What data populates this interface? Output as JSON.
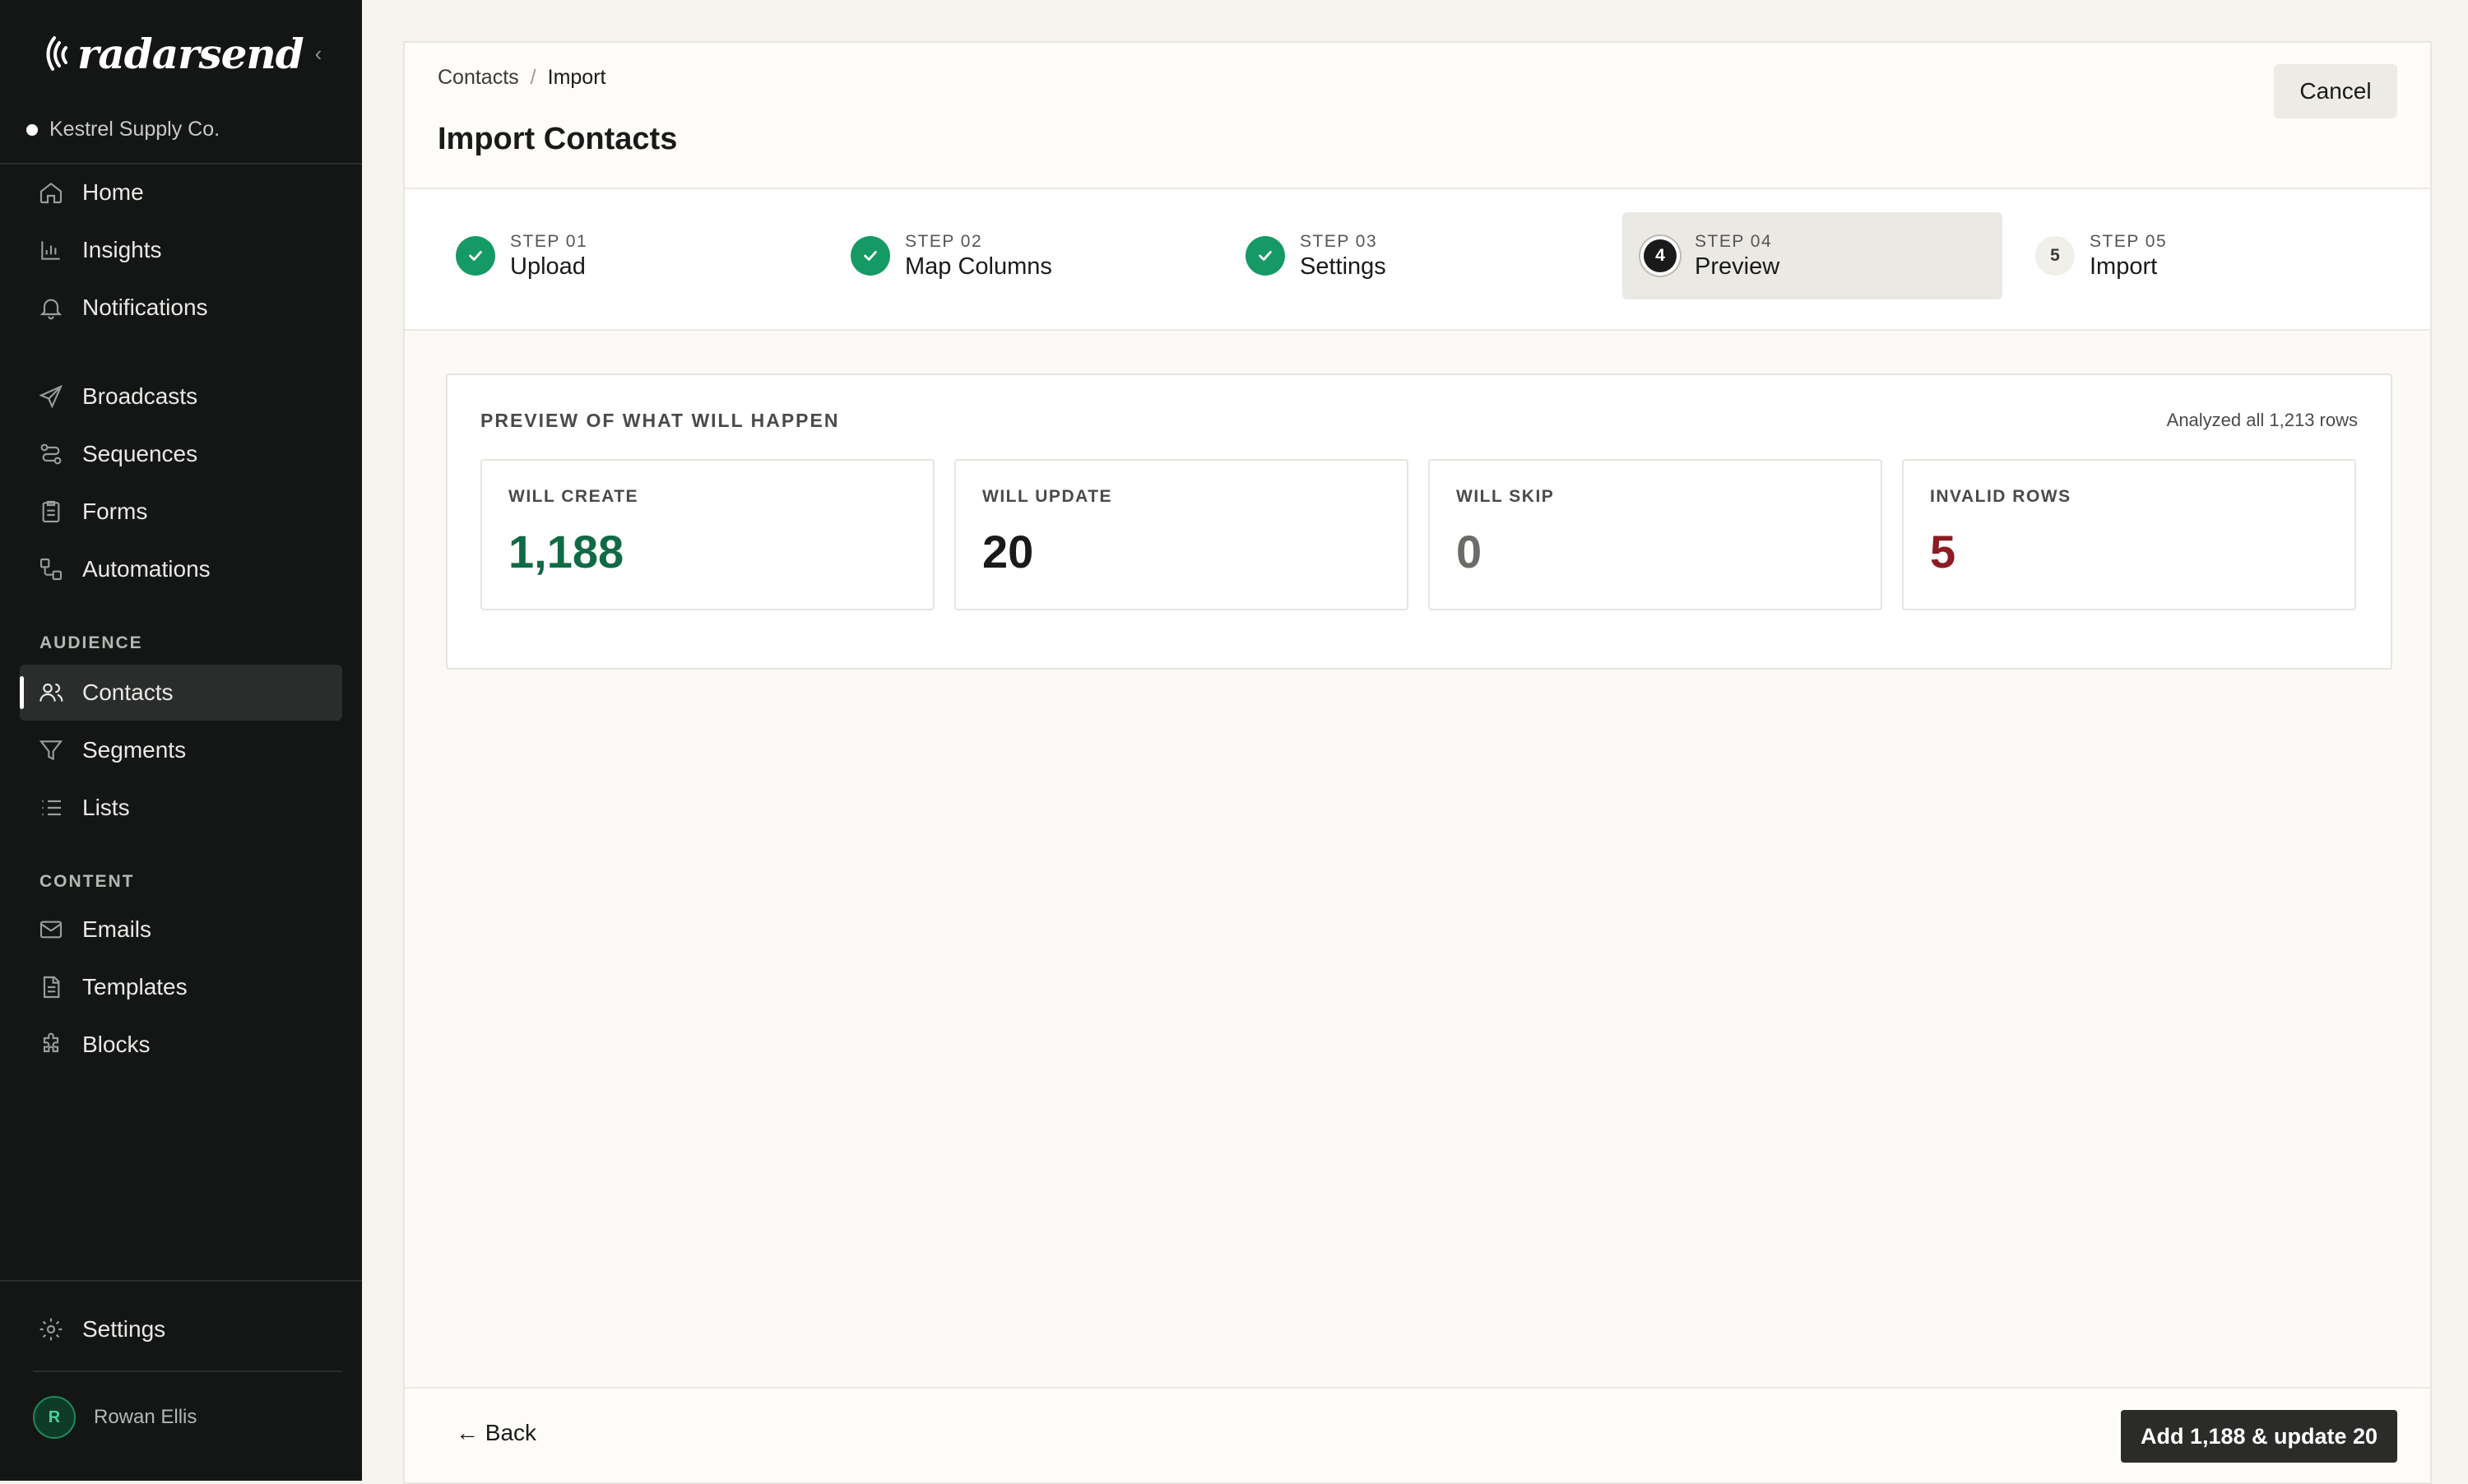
{
  "app": {
    "brand": "radarsend",
    "workspace": "Kestrel Supply Co."
  },
  "sidebar": {
    "collapse_glyph": "‹",
    "main_items": [
      {
        "label": "Home",
        "icon": "home-icon"
      },
      {
        "label": "Insights",
        "icon": "chart-icon"
      },
      {
        "label": "Notifications",
        "icon": "bell-icon"
      }
    ],
    "engage_items": [
      {
        "label": "Broadcasts",
        "icon": "send-icon"
      },
      {
        "label": "Sequences",
        "icon": "sequence-icon"
      },
      {
        "label": "Forms",
        "icon": "clipboard-icon"
      },
      {
        "label": "Automations",
        "icon": "workflow-icon"
      }
    ],
    "audience_label": "AUDIENCE",
    "audience_items": [
      {
        "label": "Contacts",
        "icon": "users-icon",
        "active": true
      },
      {
        "label": "Segments",
        "icon": "filter-icon"
      },
      {
        "label": "Lists",
        "icon": "list-icon"
      }
    ],
    "content_label": "CONTENT",
    "content_items": [
      {
        "label": "Emails",
        "icon": "mail-icon"
      },
      {
        "label": "Templates",
        "icon": "document-icon"
      },
      {
        "label": "Blocks",
        "icon": "puzzle-icon"
      }
    ],
    "settings": {
      "label": "Settings",
      "icon": "gear-icon"
    },
    "user": {
      "initial": "R",
      "name": "Rowan Ellis"
    }
  },
  "header": {
    "breadcrumb": [
      "Contacts",
      "Import"
    ],
    "breadcrumb_sep": "/",
    "title": "Import Contacts",
    "cancel_label": "Cancel"
  },
  "steps": [
    {
      "label": "STEP 01",
      "name": "Upload",
      "state": "done"
    },
    {
      "label": "STEP 02",
      "name": "Map Columns",
      "state": "done"
    },
    {
      "label": "STEP 03",
      "name": "Settings",
      "state": "done"
    },
    {
      "label": "STEP 04",
      "name": "Preview",
      "state": "current",
      "number": "4"
    },
    {
      "label": "STEP 05",
      "name": "Import",
      "state": "todo",
      "number": "5"
    }
  ],
  "preview": {
    "title": "PREVIEW OF WHAT WILL HAPPEN",
    "meta": "Analyzed all 1,213 rows",
    "stats": [
      {
        "label": "WILL CREATE",
        "value": "1,188",
        "color": "#0f6a45"
      },
      {
        "label": "WILL UPDATE",
        "value": "20",
        "color": "#1a1a1a"
      },
      {
        "label": "WILL SKIP",
        "value": "0",
        "color": "#6b6b68"
      },
      {
        "label": "INVALID ROWS",
        "value": "5",
        "color": "#8c1c22"
      }
    ]
  },
  "footer": {
    "back_label": "← Back",
    "primary_label": "Add 1,188 & update 20"
  }
}
